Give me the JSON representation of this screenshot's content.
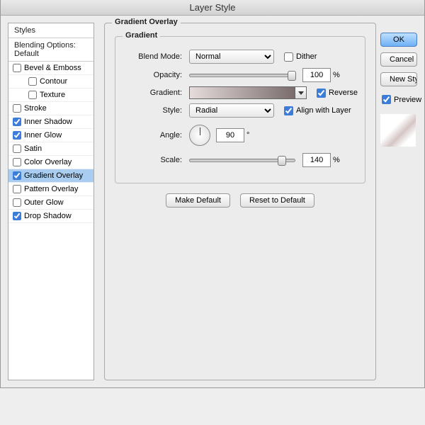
{
  "window": {
    "title": "Layer Style"
  },
  "sidebar": {
    "styles_header": "Styles",
    "blending_header": "Blending Options: Default",
    "items": [
      {
        "label": "Bevel & Emboss",
        "checked": false,
        "indent": 0
      },
      {
        "label": "Contour",
        "checked": false,
        "indent": 1
      },
      {
        "label": "Texture",
        "checked": false,
        "indent": 1
      },
      {
        "label": "Stroke",
        "checked": false,
        "indent": 0
      },
      {
        "label": "Inner Shadow",
        "checked": true,
        "indent": 0
      },
      {
        "label": "Inner Glow",
        "checked": true,
        "indent": 0
      },
      {
        "label": "Satin",
        "checked": false,
        "indent": 0
      },
      {
        "label": "Color Overlay",
        "checked": false,
        "indent": 0
      },
      {
        "label": "Gradient Overlay",
        "checked": true,
        "indent": 0,
        "selected": true
      },
      {
        "label": "Pattern Overlay",
        "checked": false,
        "indent": 0
      },
      {
        "label": "Outer Glow",
        "checked": false,
        "indent": 0
      },
      {
        "label": "Drop Shadow",
        "checked": true,
        "indent": 0
      }
    ]
  },
  "panel": {
    "title": "Gradient Overlay",
    "group_title": "Gradient",
    "labels": {
      "blend_mode": "Blend Mode:",
      "opacity": "Opacity:",
      "gradient": "Gradient:",
      "style": "Style:",
      "angle": "Angle:",
      "scale": "Scale:"
    },
    "blend_mode_value": "Normal",
    "dither": {
      "label": "Dither",
      "checked": false
    },
    "opacity": {
      "value": "100",
      "unit": "%"
    },
    "reverse": {
      "label": "Reverse",
      "checked": true
    },
    "style_value": "Radial",
    "align": {
      "label": "Align with Layer",
      "checked": true
    },
    "angle": {
      "value": "90",
      "unit": "°"
    },
    "scale": {
      "value": "140",
      "unit": "%"
    },
    "buttons": {
      "make_default": "Make Default",
      "reset": "Reset to Default"
    }
  },
  "right": {
    "ok": "OK",
    "cancel": "Cancel",
    "new_style": "New Style...",
    "preview_label": "Preview",
    "preview_checked": true
  }
}
